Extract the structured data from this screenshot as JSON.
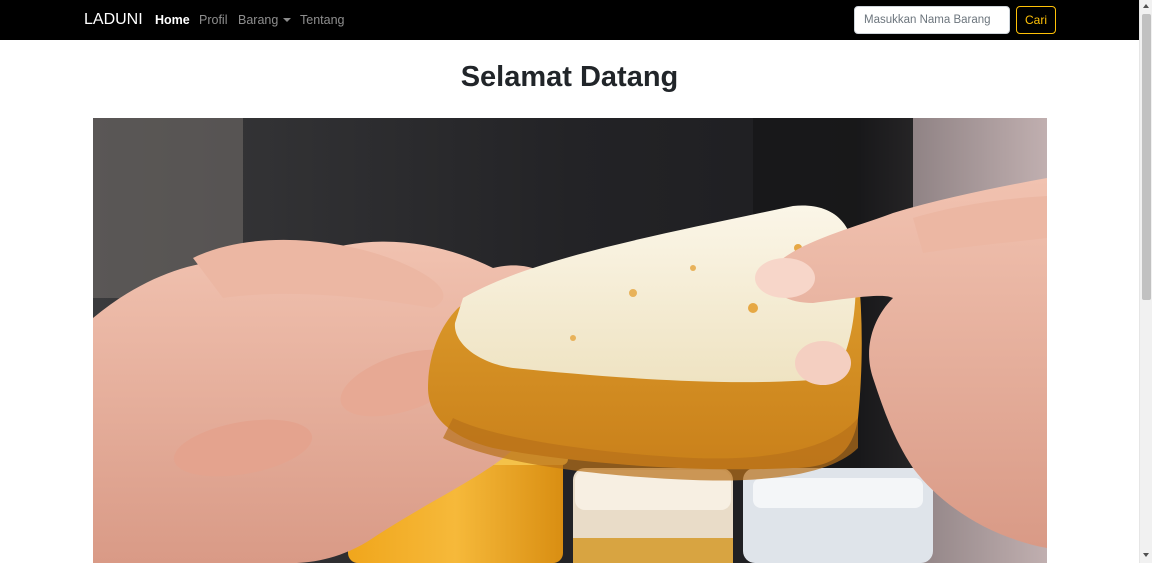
{
  "navbar": {
    "brand": "LADUNI",
    "links": [
      {
        "label": "Home",
        "active": true
      },
      {
        "label": "Profil",
        "active": false
      },
      {
        "label": "Barang",
        "active": false,
        "dropdown": true
      },
      {
        "label": "Tentang",
        "active": false
      }
    ],
    "search": {
      "placeholder": "Masukkan Nama Barang",
      "value": "",
      "button_label": "Cari"
    }
  },
  "main": {
    "title": "Selamat Datang",
    "hero_image": "photo of hands holding a piece of honeycomb"
  },
  "colors": {
    "navbar_bg": "#000000",
    "accent_outline": "#ffc107",
    "text_dark": "#212529"
  }
}
